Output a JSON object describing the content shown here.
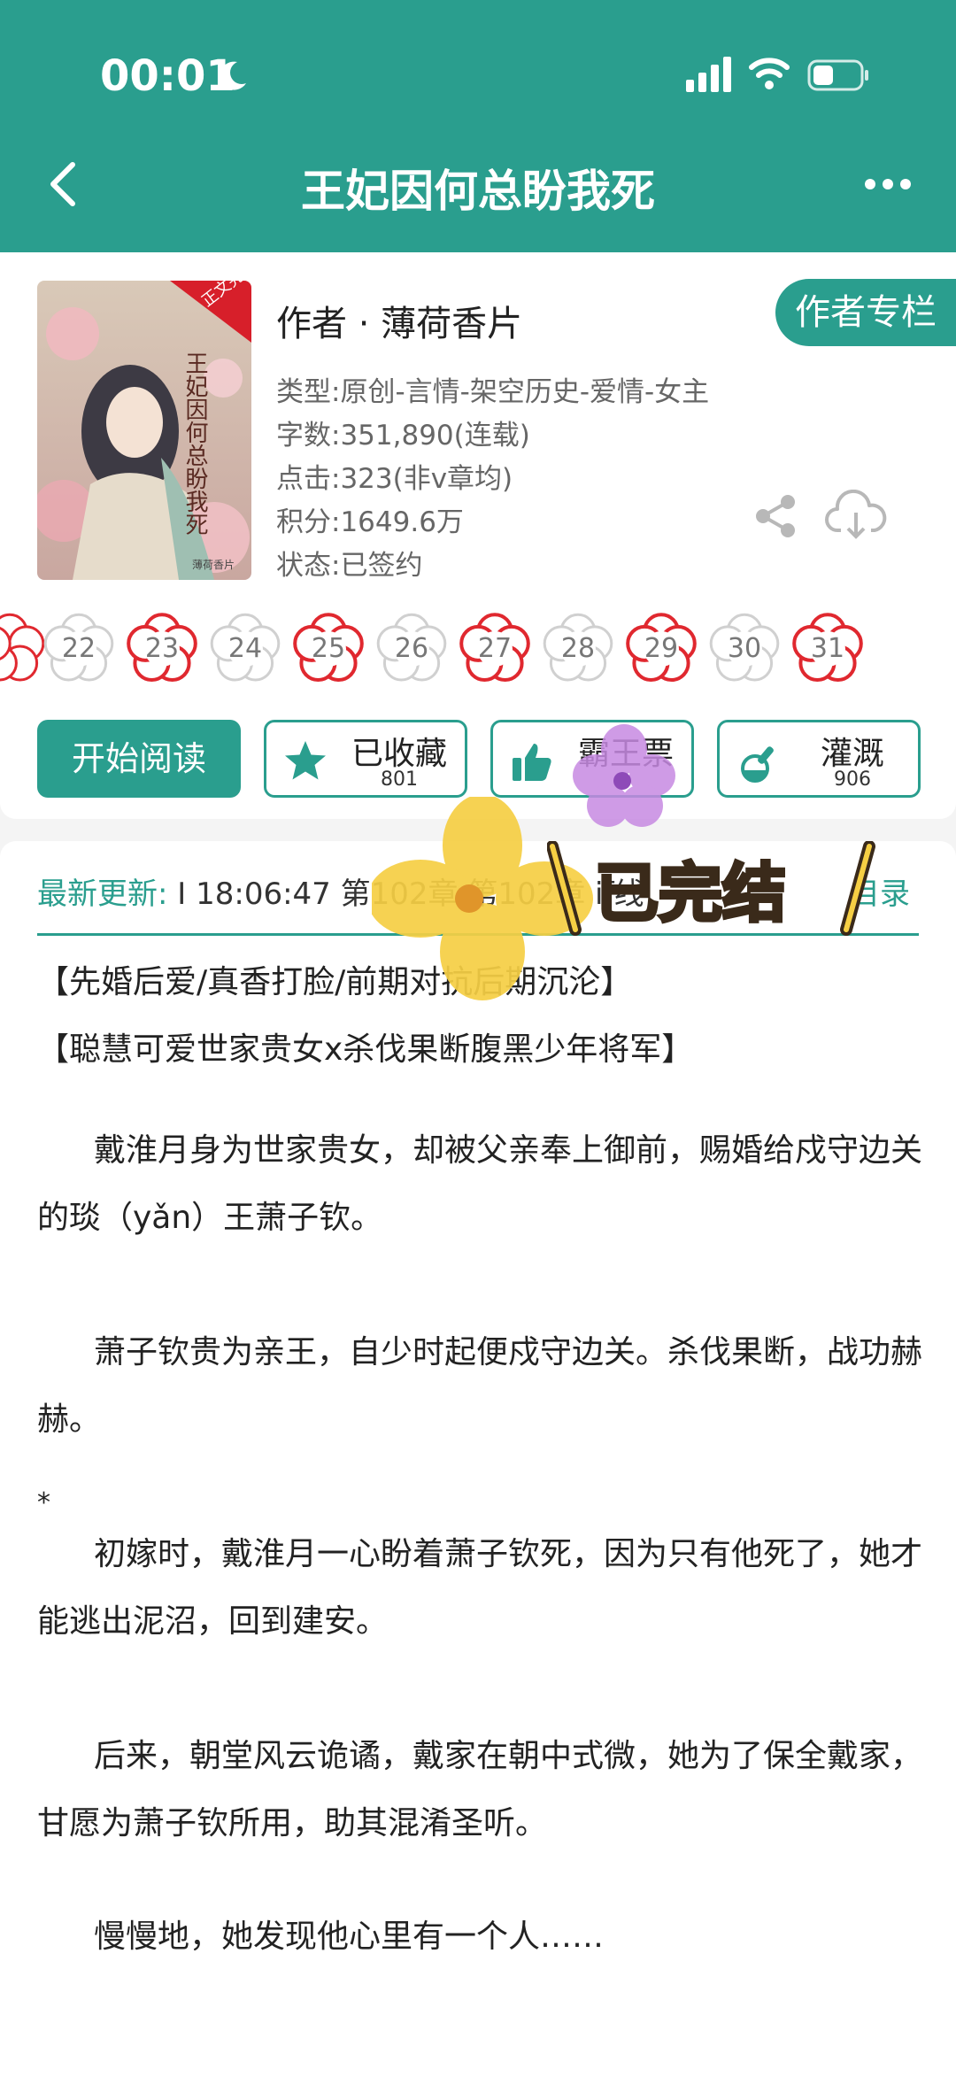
{
  "status_bar": {
    "time": "00:01"
  },
  "nav": {
    "title": "王妃因何总盼我死"
  },
  "book": {
    "author_line": "作者 · 薄荷香片",
    "author_column_btn": "作者专栏",
    "type": "类型:原创-言情-架空历史-爱情-女主",
    "words": "字数:351,890(连载)",
    "clicks": "点击:323(非v章均)",
    "score": "积分:1649.6万",
    "state": "状态:已签约",
    "cover_badge": "正文完结",
    "cover_title": "王妃因何总盼我死",
    "cover_author": "薄荷香片"
  },
  "flowers": [
    "22",
    "23",
    "24",
    "25",
    "26",
    "27",
    "28",
    "29",
    "30",
    "31"
  ],
  "actions": {
    "read": "开始阅读",
    "fav_label": "已收藏",
    "fav_count": "801",
    "vote_label": "霸王票",
    "water_label": "灌溉",
    "water_count": "906"
  },
  "update": {
    "label": "最新更新:",
    "text": "I 18:06:47  第102章 第102章 if线",
    "catalog": "目录"
  },
  "tags": [
    "【先婚后爱/真香打脸/前期对抗后期沉沦】",
    "【聪慧可爱世家贵女x杀伐果断腹黑少年将军】"
  ],
  "paragraphs": [
    "戴淮月身为世家贵女，却被父亲奉上御前，赐婚给戍守边关的琰（yǎn）王萧子钦。",
    "萧子钦贵为亲王，自少时起便戍守边关。杀伐果断，战功赫赫。",
    "初嫁时，戴淮月一心盼着萧子钦死，因为只有他死了，她才能逃出泥沼，回到建安。",
    "后来，朝堂风云诡谲，戴家在朝中式微，她为了保全戴家，甘愿为萧子钦所用，助其混淆圣听。",
    "慢慢地，她发现他心里有一个人……"
  ],
  "asterisk": "*",
  "sticker": {
    "text": "已完结"
  },
  "colors": {
    "accent": "#2a9e8e",
    "flower_red": "#e0282f"
  }
}
